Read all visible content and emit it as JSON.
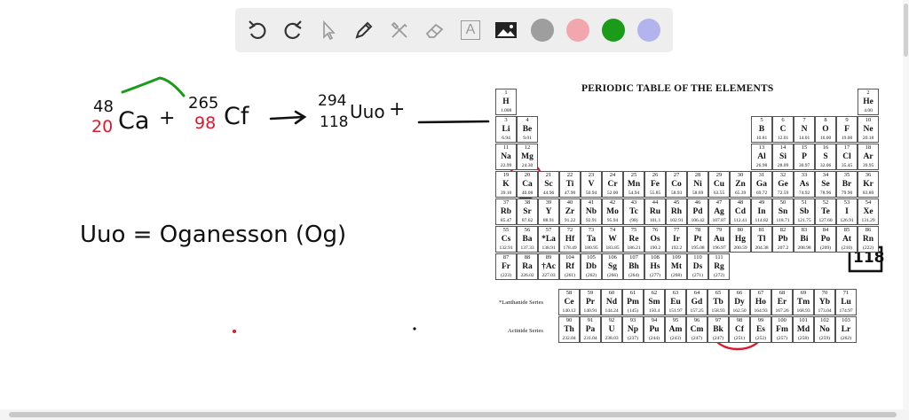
{
  "toolbar": {
    "tools": [
      "undo-icon",
      "redo-icon",
      "select-icon",
      "pen-icon",
      "tools-icon",
      "eraser-icon",
      "text-icon",
      "image-icon"
    ],
    "text_tool_label": "A",
    "colors": [
      "#9e9e9e",
      "#f2a7ae",
      "#1a9c1a",
      "#b3b3ee"
    ]
  },
  "handwriting": {
    "ca_mass": "48",
    "ca_atomic": "20",
    "ca_symbol": "Ca",
    "plus1": "+",
    "cf_mass": "265",
    "cf_atomic": "98",
    "cf_symbol": "Cf",
    "arrow": "→",
    "uuo_mass": "294",
    "uuo_atomic": "118",
    "uuo_symbol": "Uuo",
    "plus2": "+",
    "equation2": "Uuo = Oganesson (Og)",
    "label118": "118"
  },
  "periodic_table": {
    "title": "PERIODIC TABLE OF THE ELEMENTS",
    "lanthanide_label": "*Lanthanide Series",
    "actinide_label": "Actinide Series",
    "rows": [
      [
        [
          "1",
          "H",
          "1.008",
          0
        ],
        [
          "2",
          "He",
          "4.00",
          17
        ]
      ],
      [
        [
          "3",
          "Li",
          "6.94",
          0
        ],
        [
          "4",
          "Be",
          "9.01",
          1
        ],
        [
          "5",
          "B",
          "10.81",
          12
        ],
        [
          "6",
          "C",
          "12.01",
          13
        ],
        [
          "7",
          "N",
          "14.01",
          14
        ],
        [
          "8",
          "O",
          "16.00",
          15
        ],
        [
          "9",
          "F",
          "19.00",
          16
        ],
        [
          "10",
          "Ne",
          "20.18",
          17
        ]
      ],
      [
        [
          "11",
          "Na",
          "22.99",
          0
        ],
        [
          "12",
          "Mg",
          "24.30",
          1
        ],
        [
          "13",
          "Al",
          "26.98",
          12
        ],
        [
          "14",
          "Si",
          "28.09",
          13
        ],
        [
          "15",
          "P",
          "30.97",
          14
        ],
        [
          "16",
          "S",
          "32.06",
          15
        ],
        [
          "17",
          "Cl",
          "35.45",
          16
        ],
        [
          "18",
          "Ar",
          "39.95",
          17
        ]
      ],
      [
        [
          "19",
          "K",
          "39.10",
          0
        ],
        [
          "20",
          "Ca",
          "40.08",
          1
        ],
        [
          "21",
          "Sc",
          "44.96",
          2
        ],
        [
          "22",
          "Ti",
          "47.90",
          3
        ],
        [
          "23",
          "V",
          "50.94",
          4
        ],
        [
          "24",
          "Cr",
          "52.00",
          5
        ],
        [
          "25",
          "Mn",
          "54.94",
          6
        ],
        [
          "26",
          "Fe",
          "55.85",
          7
        ],
        [
          "27",
          "Co",
          "58.93",
          8
        ],
        [
          "28",
          "Ni",
          "58.69",
          9
        ],
        [
          "29",
          "Cu",
          "63.55",
          10
        ],
        [
          "30",
          "Zn",
          "65.39",
          11
        ],
        [
          "31",
          "Ga",
          "69.72",
          12
        ],
        [
          "32",
          "Ge",
          "72.59",
          13
        ],
        [
          "33",
          "As",
          "74.92",
          14
        ],
        [
          "34",
          "Se",
          "78.96",
          15
        ],
        [
          "35",
          "Br",
          "79.90",
          16
        ],
        [
          "36",
          "Kr",
          "83.80",
          17
        ]
      ],
      [
        [
          "37",
          "Rb",
          "85.47",
          0
        ],
        [
          "38",
          "Sr",
          "87.62",
          1
        ],
        [
          "39",
          "Y",
          "88.91",
          2
        ],
        [
          "40",
          "Zr",
          "91.22",
          3
        ],
        [
          "41",
          "Nb",
          "92.91",
          4
        ],
        [
          "42",
          "Mo",
          "95.94",
          5
        ],
        [
          "43",
          "Tc",
          "(98)",
          6
        ],
        [
          "44",
          "Ru",
          "101.1",
          7
        ],
        [
          "45",
          "Rh",
          "102.91",
          8
        ],
        [
          "46",
          "Pd",
          "106.42",
          9
        ],
        [
          "47",
          "Ag",
          "107.87",
          10
        ],
        [
          "48",
          "Cd",
          "112.41",
          11
        ],
        [
          "49",
          "In",
          "114.82",
          12
        ],
        [
          "50",
          "Sn",
          "118.71",
          13
        ],
        [
          "51",
          "Sb",
          "121.75",
          14
        ],
        [
          "52",
          "Te",
          "127.60",
          15
        ],
        [
          "53",
          "I",
          "126.91",
          16
        ],
        [
          "54",
          "Xe",
          "131.29",
          17
        ]
      ],
      [
        [
          "55",
          "Cs",
          "132.91",
          0
        ],
        [
          "56",
          "Ba",
          "137.33",
          1
        ],
        [
          "57",
          "*La",
          "138.91",
          2
        ],
        [
          "72",
          "Hf",
          "178.49",
          3
        ],
        [
          "73",
          "Ta",
          "180.95",
          4
        ],
        [
          "74",
          "W",
          "183.85",
          5
        ],
        [
          "75",
          "Re",
          "186.21",
          6
        ],
        [
          "76",
          "Os",
          "190.2",
          7
        ],
        [
          "77",
          "Ir",
          "192.2",
          8
        ],
        [
          "78",
          "Pt",
          "195.08",
          9
        ],
        [
          "79",
          "Au",
          "196.97",
          10
        ],
        [
          "80",
          "Hg",
          "200.59",
          11
        ],
        [
          "81",
          "Tl",
          "204.38",
          12
        ],
        [
          "82",
          "Pb",
          "207.2",
          13
        ],
        [
          "83",
          "Bi",
          "208.98",
          14
        ],
        [
          "84",
          "Po",
          "(209)",
          15
        ],
        [
          "85",
          "At",
          "(210)",
          16
        ],
        [
          "86",
          "Rn",
          "(222)",
          17
        ]
      ],
      [
        [
          "87",
          "Fr",
          "(223)",
          0
        ],
        [
          "88",
          "Ra",
          "226.02",
          1
        ],
        [
          "89",
          "†Ac",
          "227.03",
          2
        ],
        [
          "104",
          "Rf",
          "(261)",
          3
        ],
        [
          "105",
          "Db",
          "(262)",
          4
        ],
        [
          "106",
          "Sg",
          "(266)",
          5
        ],
        [
          "107",
          "Bh",
          "(264)",
          6
        ],
        [
          "108",
          "Hs",
          "(277)",
          7
        ],
        [
          "109",
          "Mt",
          "(268)",
          8
        ],
        [
          "110",
          "Ds",
          "(271)",
          9
        ],
        [
          "111",
          "Rg",
          "(272)",
          10
        ]
      ]
    ],
    "lanthanides": [
      [
        "58",
        "Ce",
        "140.12"
      ],
      [
        "59",
        "Pr",
        "140.91"
      ],
      [
        "60",
        "Nd",
        "144.24"
      ],
      [
        "61",
        "Pm",
        "(145)"
      ],
      [
        "62",
        "Sm",
        "150.4"
      ],
      [
        "63",
        "Eu",
        "151.97"
      ],
      [
        "64",
        "Gd",
        "157.25"
      ],
      [
        "65",
        "Tb",
        "158.93"
      ],
      [
        "66",
        "Dy",
        "162.50"
      ],
      [
        "67",
        "Ho",
        "164.93"
      ],
      [
        "68",
        "Er",
        "167.26"
      ],
      [
        "69",
        "Tm",
        "168.93"
      ],
      [
        "70",
        "Yb",
        "173.04"
      ],
      [
        "71",
        "Lu",
        "174.97"
      ]
    ],
    "actinides": [
      [
        "90",
        "Th",
        "232.04"
      ],
      [
        "91",
        "Pa",
        "231.04"
      ],
      [
        "92",
        "U",
        "238.03"
      ],
      [
        "93",
        "Np",
        "(237)"
      ],
      [
        "94",
        "Pu",
        "(244)"
      ],
      [
        "95",
        "Am",
        "(243)"
      ],
      [
        "96",
        "Cm",
        "(247)"
      ],
      [
        "97",
        "Bk",
        "(247)"
      ],
      [
        "98",
        "Cf",
        "(251)"
      ],
      [
        "99",
        "Es",
        "(252)"
      ],
      [
        "100",
        "Fm",
        "(257)"
      ],
      [
        "101",
        "Md",
        "(258)"
      ],
      [
        "102",
        "No",
        "(259)"
      ],
      [
        "103",
        "Lr",
        "(262)"
      ]
    ]
  },
  "ink_colors": {
    "black": "#111111",
    "red": "#e0182d",
    "green": "#1a9c1a"
  }
}
